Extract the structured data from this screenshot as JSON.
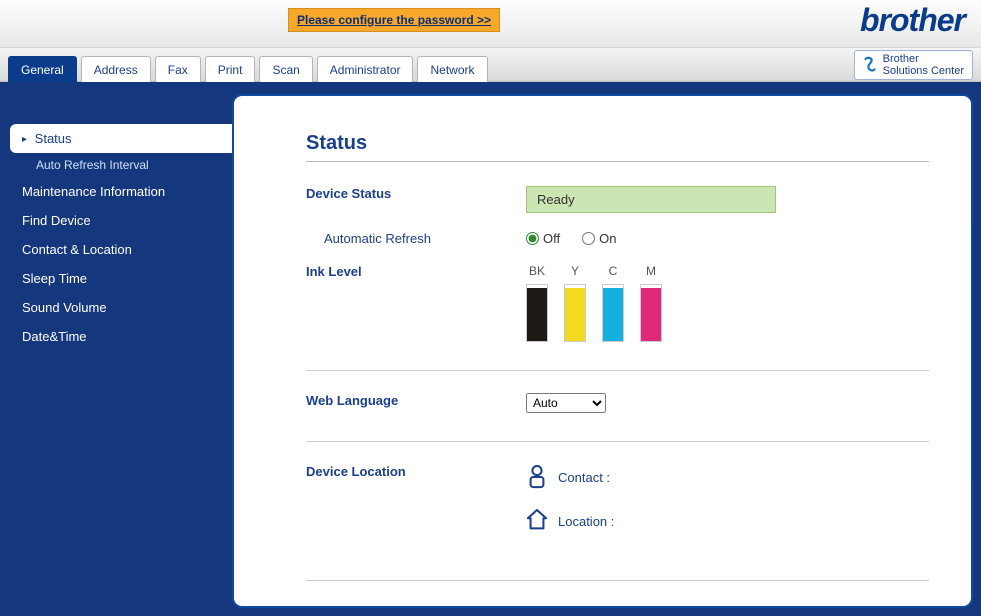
{
  "banner": {
    "configure_password": "Please configure the password >>",
    "brand": "brother",
    "solutions_center_line1": "Brother",
    "solutions_center_line2": "Solutions Center"
  },
  "tabs": [
    {
      "label": "General",
      "active": true
    },
    {
      "label": "Address",
      "active": false
    },
    {
      "label": "Fax",
      "active": false
    },
    {
      "label": "Print",
      "active": false
    },
    {
      "label": "Scan",
      "active": false
    },
    {
      "label": "Administrator",
      "active": false
    },
    {
      "label": "Network",
      "active": false
    }
  ],
  "sidebar": {
    "items": [
      {
        "label": "Status",
        "active": true,
        "children": [
          {
            "label": "Auto Refresh Interval"
          }
        ]
      },
      {
        "label": "Maintenance Information"
      },
      {
        "label": "Find Device"
      },
      {
        "label": "Contact & Location"
      },
      {
        "label": "Sleep Time"
      },
      {
        "label": "Sound Volume"
      },
      {
        "label": "Date&Time"
      }
    ]
  },
  "page": {
    "title": "Status",
    "device_status_label": "Device Status",
    "device_status_value": "Ready",
    "auto_refresh_label": "Automatic Refresh",
    "auto_refresh_off": "Off",
    "auto_refresh_on": "On",
    "auto_refresh_selected": "Off",
    "ink_level_label": "Ink Level",
    "inks": [
      {
        "name": "BK",
        "color": "#1d1915",
        "level": 95
      },
      {
        "name": "Y",
        "color": "#f2da1f",
        "level": 95
      },
      {
        "name": "C",
        "color": "#14b0e0",
        "level": 95
      },
      {
        "name": "M",
        "color": "#e0287a",
        "level": 95
      }
    ],
    "web_language_label": "Web Language",
    "web_language_value": "Auto",
    "device_location_label": "Device Location",
    "contact_label": "Contact :",
    "contact_value": "",
    "location_label": "Location :",
    "location_value": ""
  }
}
